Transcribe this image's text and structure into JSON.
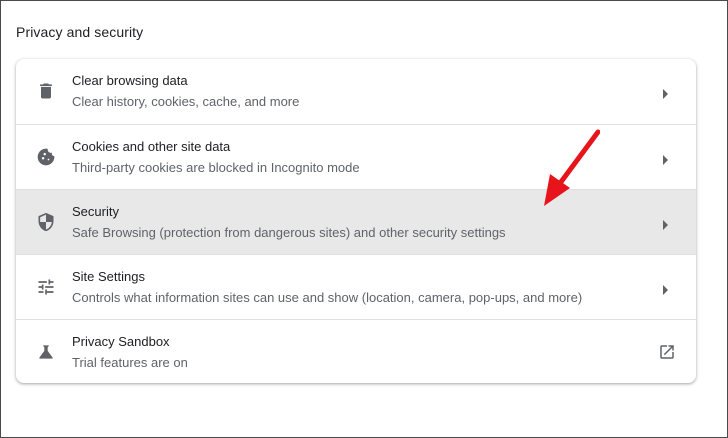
{
  "section": {
    "title": "Privacy and security"
  },
  "rows": [
    {
      "title": "Clear browsing data",
      "subtitle": "Clear history, cookies, cache, and more",
      "icon": "trash-icon",
      "action": "chevron-right-icon"
    },
    {
      "title": "Cookies and other site data",
      "subtitle": "Third-party cookies are blocked in Incognito mode",
      "icon": "cookie-icon",
      "action": "chevron-right-icon"
    },
    {
      "title": "Security",
      "subtitle": "Safe Browsing (protection from dangerous sites) and other security settings",
      "icon": "shield-icon",
      "action": "chevron-right-icon"
    },
    {
      "title": "Site Settings",
      "subtitle": "Controls what information sites can use and show (location, camera, pop-ups, and more)",
      "icon": "sliders-icon",
      "action": "chevron-right-icon"
    },
    {
      "title": "Privacy Sandbox",
      "subtitle": "Trial features are on",
      "icon": "flask-icon",
      "action": "open-in-new-icon"
    }
  ],
  "colors": {
    "highlight_row": "#e8e8e8",
    "annotation_arrow": "#e8141b",
    "icon": "#5f6368"
  }
}
